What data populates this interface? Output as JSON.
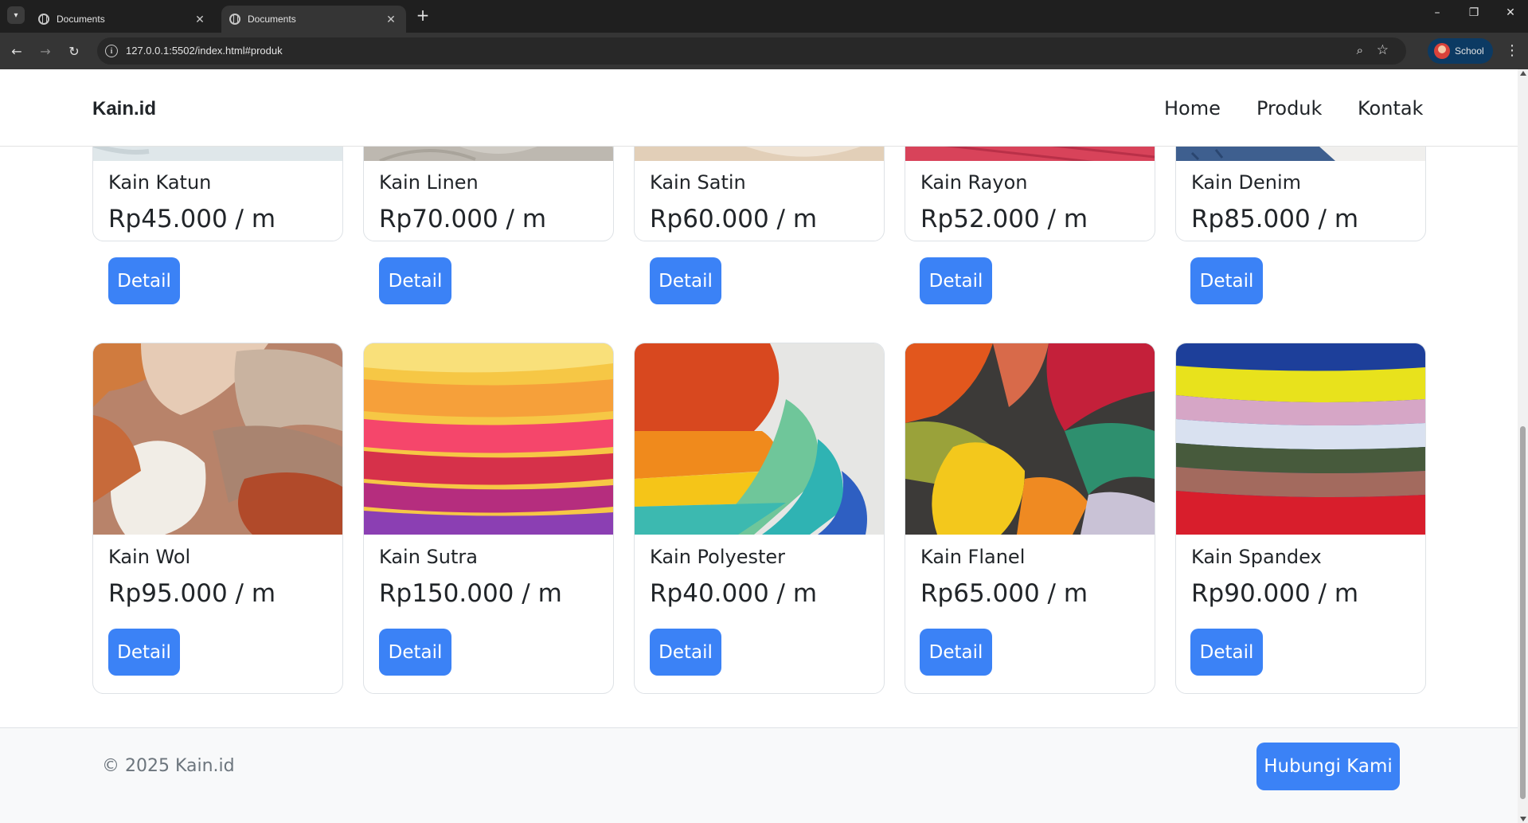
{
  "browser": {
    "tabs": [
      {
        "title": "Documents",
        "active": false
      },
      {
        "title": "Documents",
        "active": true
      }
    ],
    "url": "127.0.0.1:5502/index.html#produk",
    "profile_label": "School"
  },
  "site": {
    "brand": "Kain.id",
    "nav": [
      "Home",
      "Produk",
      "Kontak"
    ]
  },
  "products_top": [
    {
      "name": "Kain Katun",
      "price": "Rp45.000 / m",
      "button": "Detail"
    },
    {
      "name": "Kain Linen",
      "price": "Rp70.000 / m",
      "button": "Detail"
    },
    {
      "name": "Kain Satin",
      "price": "Rp60.000 / m",
      "button": "Detail"
    },
    {
      "name": "Kain Rayon",
      "price": "Rp52.000 / m",
      "button": "Detail"
    },
    {
      "name": "Kain Denim",
      "price": "Rp85.000 / m",
      "button": "Detail"
    }
  ],
  "products_bottom": [
    {
      "name": "Kain Wol",
      "price": "Rp95.000 / m",
      "button": "Detail"
    },
    {
      "name": "Kain Sutra",
      "price": "Rp150.000 / m",
      "button": "Detail"
    },
    {
      "name": "Kain Polyester",
      "price": "Rp40.000 / m",
      "button": "Detail"
    },
    {
      "name": "Kain Flanel",
      "price": "Rp65.000 / m",
      "button": "Detail"
    },
    {
      "name": "Kain Spandex",
      "price": "Rp90.000 / m",
      "button": "Detail"
    }
  ],
  "footer": {
    "copyright": "© 2025 Kain.id",
    "contact_button": "Hubungi Kami"
  },
  "colors": {
    "accent": "#3b82f6",
    "text": "#212529",
    "footer_bg": "#f8f9fa"
  }
}
